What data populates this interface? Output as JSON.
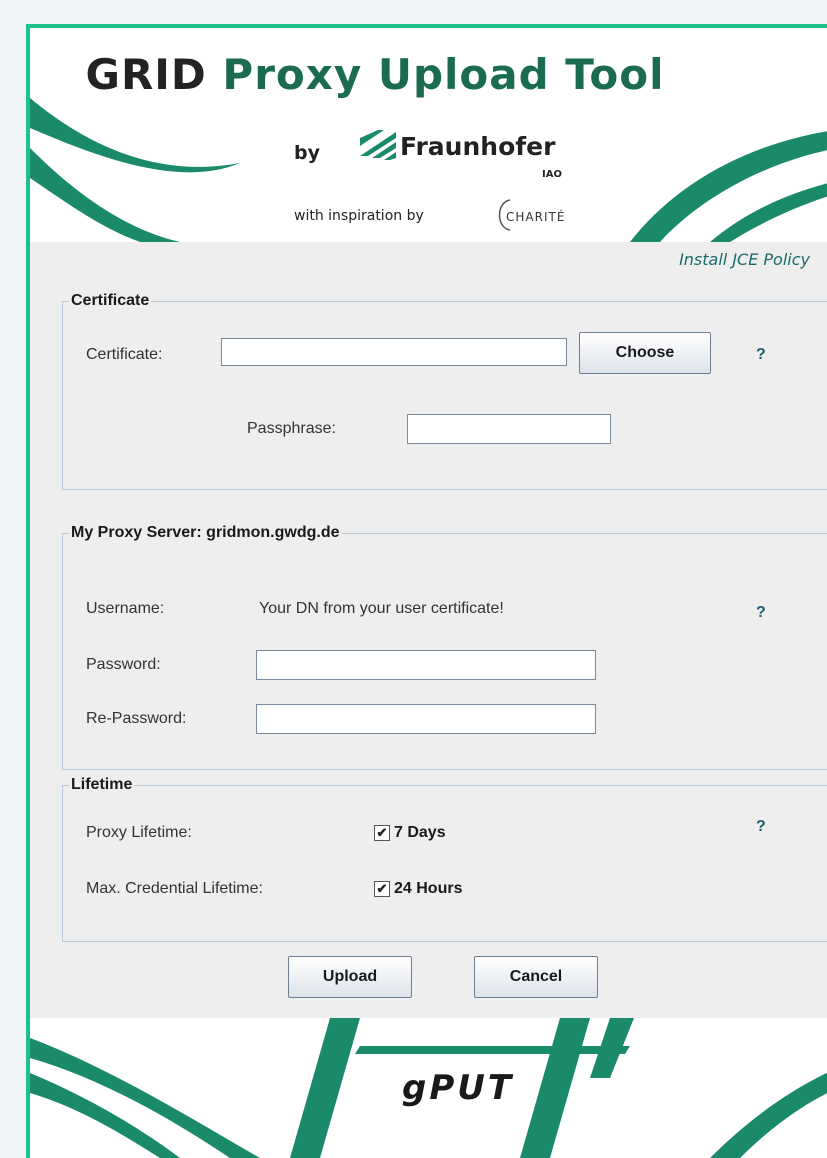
{
  "header": {
    "title_grid": "GRID",
    "title_rest": "Proxy Upload Tool",
    "by": "by",
    "org_name": "Fraunhofer",
    "org_sub": "IAO",
    "inspiration": "with inspiration by",
    "partner": "CHARITÉ"
  },
  "links": {
    "install_jce": "Install JCE Policy"
  },
  "certificate": {
    "legend": "Certificate",
    "field_label": "Certificate:",
    "field_value": "",
    "choose_label": "Choose",
    "help": "?",
    "passphrase_label": "Passphrase:",
    "passphrase_value": ""
  },
  "myproxy": {
    "legend": "My Proxy Server: gridmon.gwdg.de",
    "username_label": "Username:",
    "username_value": "Your DN from your user certificate!",
    "help": "?",
    "password_label": "Password:",
    "password_value": "",
    "repassword_label": "Re-Password:",
    "repassword_value": ""
  },
  "lifetime": {
    "legend": "Lifetime",
    "proxy_label": "Proxy Lifetime:",
    "proxy_value": "7 Days",
    "proxy_checked": true,
    "maxcred_label": "Max. Credential Lifetime:",
    "maxcred_value": "24 Hours",
    "maxcred_checked": true,
    "help": "?"
  },
  "actions": {
    "upload_label": "Upload",
    "cancel_label": "Cancel"
  },
  "footer": {
    "brand": "gPUT"
  },
  "colors": {
    "accent": "#1fbf8e",
    "brand_green": "#1a6b52",
    "swoosh": "#1a8a6a"
  },
  "icons": {
    "checkbox": "checkmark-icon",
    "logo": "fraunhofer-logo-icon"
  }
}
